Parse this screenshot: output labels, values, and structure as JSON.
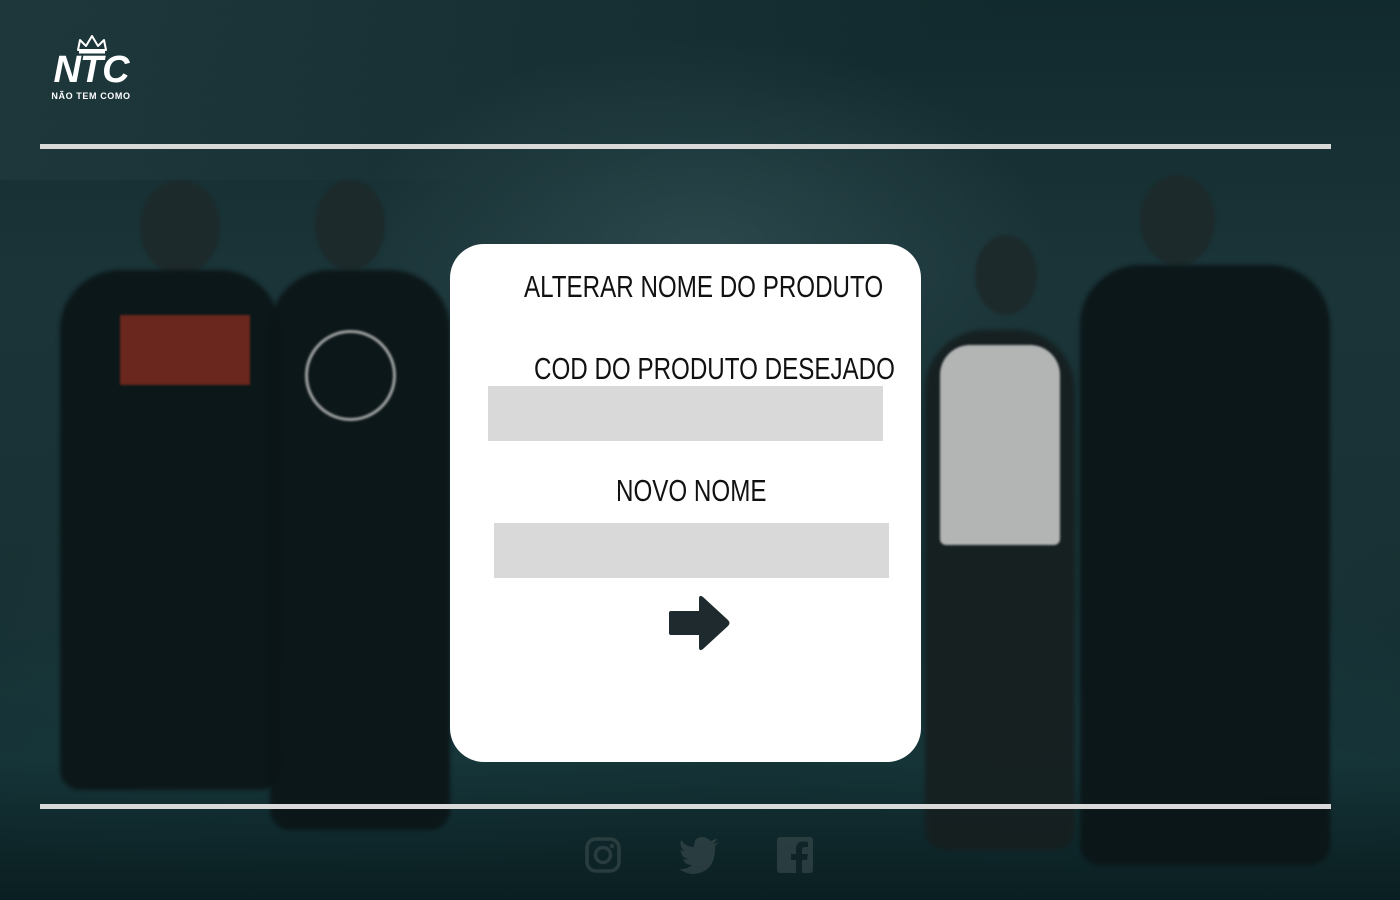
{
  "header": {
    "logo_text": "NTC",
    "logo_subtitle": "NÃO TEM COMO"
  },
  "card": {
    "title": "ALTERAR NOME DO PRODUTO",
    "code_label": "COD DO PRODUTO DESEJADO",
    "code_value": "",
    "name_label": "NOVO NOME",
    "name_value": "",
    "submit_icon": "arrow-right-icon"
  },
  "footer": {
    "social": [
      "instagram-icon",
      "twitter-icon",
      "facebook-icon"
    ]
  },
  "colors": {
    "card_bg": "#ffffff",
    "input_bg": "#d9d9d9",
    "divider": "#d9d9d9",
    "text": "#111111",
    "icon_dark": "#1e2a2e"
  }
}
